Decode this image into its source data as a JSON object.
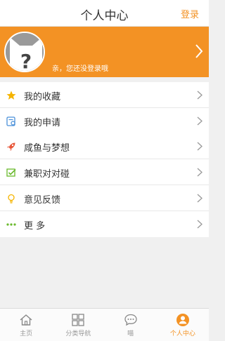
{
  "header": {
    "title": "个人中心",
    "login_label": "登录"
  },
  "profile": {
    "hint": "亲，您还没登录哦"
  },
  "menu_group_1": [
    {
      "label": "我的收藏",
      "icon": "star-icon"
    },
    {
      "label": "我的申请",
      "icon": "application-icon"
    }
  ],
  "menu_group_2": [
    {
      "label": "咸鱼与梦想",
      "icon": "rocket-icon"
    },
    {
      "label": "兼职对对碰",
      "icon": "checkbox-icon"
    },
    {
      "label": "意见反馈",
      "icon": "lightbulb-icon"
    },
    {
      "label": "更 多",
      "icon": "more-dots-icon"
    }
  ],
  "tabs": [
    {
      "label": "主页",
      "icon": "home-icon",
      "active": false
    },
    {
      "label": "分类导航",
      "icon": "grid-icon",
      "active": false
    },
    {
      "label": "喵",
      "icon": "chat-bubble-icon",
      "active": false
    },
    {
      "label": "个人中心",
      "icon": "user-icon",
      "active": true
    }
  ],
  "colors": {
    "accent": "#f39224",
    "star": "#f5b400",
    "blue": "#4a90d9",
    "green": "#6ab92d"
  }
}
